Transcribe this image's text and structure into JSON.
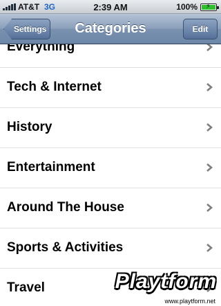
{
  "status_bar": {
    "carrier": "AT&T",
    "network": "3G",
    "time": "2:39 AM",
    "battery": "100%",
    "battery_level": 1.0,
    "signal_icon": "signal-bars-icon",
    "battery_icon": "battery-charging-icon"
  },
  "nav": {
    "title": "Categories",
    "back_label": "Settings",
    "edit_label": "Edit"
  },
  "categories": [
    {
      "label": "Everything"
    },
    {
      "label": "Tech & Internet"
    },
    {
      "label": "History"
    },
    {
      "label": "Entertainment"
    },
    {
      "label": "Around The House"
    },
    {
      "label": "Sports & Activities"
    },
    {
      "label": "Travel"
    }
  ],
  "watermark": {
    "logo": "Playtform",
    "url": "www.playtform.net"
  },
  "colors": {
    "nav_bar": "#7a91af",
    "chevron": "#7f7f7f",
    "separator": "#e0e0e0"
  }
}
